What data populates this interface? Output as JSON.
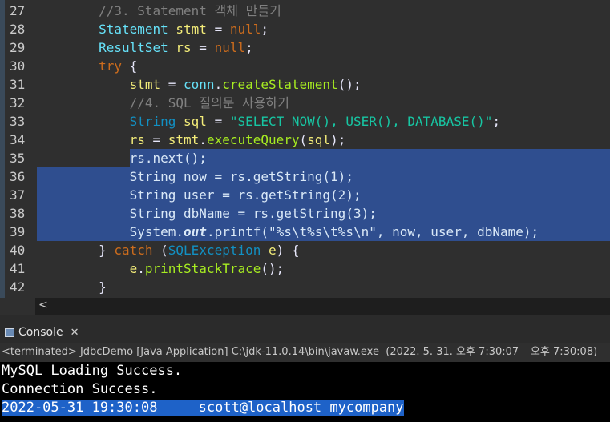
{
  "colors": {
    "background": "#2f2f2f",
    "selection": "#2f4e8f",
    "comment": "#808080",
    "keyword": "#cc6c1d",
    "type": "#1290c3",
    "type_plain": "#66e1f8",
    "identifier": "#f3ec79",
    "field": "#66e1f8",
    "method": "#a7ec21",
    "string": "#17c6a3",
    "operator": "#e6e6fa",
    "default": "#d9e8f7",
    "console_bg": "#000000",
    "console_selection": "#1e62c8"
  },
  "editor": {
    "lines": [
      {
        "num": "27",
        "selected": false,
        "tokens": [
          {
            "t": "        //3. Statement 객체 만들기",
            "c": "comment"
          }
        ]
      },
      {
        "num": "28",
        "selected": false,
        "tokens": [
          {
            "t": "        ",
            "c": "default"
          },
          {
            "t": "Statement",
            "c": "type_plain"
          },
          {
            "t": " ",
            "c": "default"
          },
          {
            "t": "stmt",
            "c": "identifier"
          },
          {
            "t": " = ",
            "c": "operator"
          },
          {
            "t": "null",
            "c": "keyword"
          },
          {
            "t": ";",
            "c": "operator"
          }
        ]
      },
      {
        "num": "29",
        "selected": false,
        "tokens": [
          {
            "t": "        ",
            "c": "default"
          },
          {
            "t": "ResultSet",
            "c": "type_plain"
          },
          {
            "t": " ",
            "c": "default"
          },
          {
            "t": "rs",
            "c": "identifier"
          },
          {
            "t": " = ",
            "c": "operator"
          },
          {
            "t": "null",
            "c": "keyword"
          },
          {
            "t": ";",
            "c": "operator"
          }
        ]
      },
      {
        "num": "30",
        "selected": false,
        "tokens": [
          {
            "t": "        ",
            "c": "default"
          },
          {
            "t": "try",
            "c": "keyword"
          },
          {
            "t": " {",
            "c": "operator"
          }
        ]
      },
      {
        "num": "31",
        "selected": false,
        "tokens": [
          {
            "t": "            ",
            "c": "default"
          },
          {
            "t": "stmt",
            "c": "identifier"
          },
          {
            "t": " = ",
            "c": "operator"
          },
          {
            "t": "conn",
            "c": "field"
          },
          {
            "t": ".",
            "c": "operator"
          },
          {
            "t": "createStatement",
            "c": "method"
          },
          {
            "t": "();",
            "c": "operator"
          }
        ]
      },
      {
        "num": "32",
        "selected": false,
        "tokens": [
          {
            "t": "            //4. SQL 질의문 사용하기",
            "c": "comment"
          }
        ]
      },
      {
        "num": "33",
        "selected": false,
        "tokens": [
          {
            "t": "            ",
            "c": "default"
          },
          {
            "t": "String",
            "c": "type"
          },
          {
            "t": " ",
            "c": "default"
          },
          {
            "t": "sql",
            "c": "identifier"
          },
          {
            "t": " = ",
            "c": "operator"
          },
          {
            "t": "\"SELECT NOW(), USER(), DATABASE()\"",
            "c": "string"
          },
          {
            "t": ";",
            "c": "operator"
          }
        ]
      },
      {
        "num": "34",
        "selected": false,
        "tokens": [
          {
            "t": "            ",
            "c": "default"
          },
          {
            "t": "rs",
            "c": "identifier"
          },
          {
            "t": " = ",
            "c": "operator"
          },
          {
            "t": "stmt",
            "c": "identifier"
          },
          {
            "t": ".",
            "c": "operator"
          },
          {
            "t": "executeQuery",
            "c": "method"
          },
          {
            "t": "(",
            "c": "operator"
          },
          {
            "t": "sql",
            "c": "identifier"
          },
          {
            "t": ");",
            "c": "operator"
          }
        ]
      },
      {
        "num": "35",
        "selected": true,
        "sel_start_col": 12,
        "tokens": [
          {
            "t": "            ",
            "c": "default"
          },
          {
            "t": "rs.next();",
            "c": "default"
          }
        ]
      },
      {
        "num": "36",
        "selected": true,
        "sel_start_col": 0,
        "tokens": [
          {
            "t": "            ",
            "c": "default"
          },
          {
            "t": "String now = rs.getString(1);",
            "c": "default"
          }
        ]
      },
      {
        "num": "37",
        "selected": true,
        "sel_start_col": 0,
        "tokens": [
          {
            "t": "            ",
            "c": "default"
          },
          {
            "t": "String user = rs.getString(2);",
            "c": "default"
          }
        ]
      },
      {
        "num": "38",
        "selected": true,
        "sel_start_col": 0,
        "tokens": [
          {
            "t": "            ",
            "c": "default"
          },
          {
            "t": "String dbName = rs.getString(3);",
            "c": "default"
          }
        ]
      },
      {
        "num": "39",
        "selected": true,
        "sel_start_col": 0,
        "tokens": [
          {
            "t": "            ",
            "c": "default"
          },
          {
            "t": "System.",
            "c": "default"
          },
          {
            "t": "out",
            "c": "bolditalic"
          },
          {
            "t": ".printf(\"%s\\t%s\\t%s\\n\", now, user, dbName);",
            "c": "default"
          }
        ]
      },
      {
        "num": "40",
        "selected": false,
        "tokens": [
          {
            "t": "        ",
            "c": "default"
          },
          {
            "t": "}",
            "c": "operator"
          },
          {
            "t": " catch ",
            "c": "keyword"
          },
          {
            "t": "(",
            "c": "operator"
          },
          {
            "t": "SQLException",
            "c": "type"
          },
          {
            "t": " ",
            "c": "default"
          },
          {
            "t": "e",
            "c": "identifier"
          },
          {
            "t": ") {",
            "c": "operator"
          }
        ]
      },
      {
        "num": "41",
        "selected": false,
        "tokens": [
          {
            "t": "            ",
            "c": "default"
          },
          {
            "t": "e",
            "c": "identifier"
          },
          {
            "t": ".",
            "c": "operator"
          },
          {
            "t": "printStackTrace",
            "c": "method"
          },
          {
            "t": "();",
            "c": "operator"
          }
        ]
      },
      {
        "num": "42",
        "selected": false,
        "tokens": [
          {
            "t": "        ",
            "c": "default"
          },
          {
            "t": "}",
            "c": "operator"
          }
        ]
      }
    ]
  },
  "hscroll": {
    "arrow": "<"
  },
  "console": {
    "tab_label": "Console",
    "close_glyph": "✕",
    "status": "<terminated> JdbcDemo [Java Application] C:\\jdk-11.0.14\\bin\\javaw.exe  (2022. 5. 31. 오후 7:30:07 – 오후 7:30:08)",
    "output": [
      {
        "text": "MySQL Loading Success.",
        "selected": false
      },
      {
        "text": "Connection Success.",
        "selected": false
      },
      {
        "text": "2022-05-31 19:30:08\tscott@localhost\tmycompany",
        "selected": true
      }
    ]
  }
}
